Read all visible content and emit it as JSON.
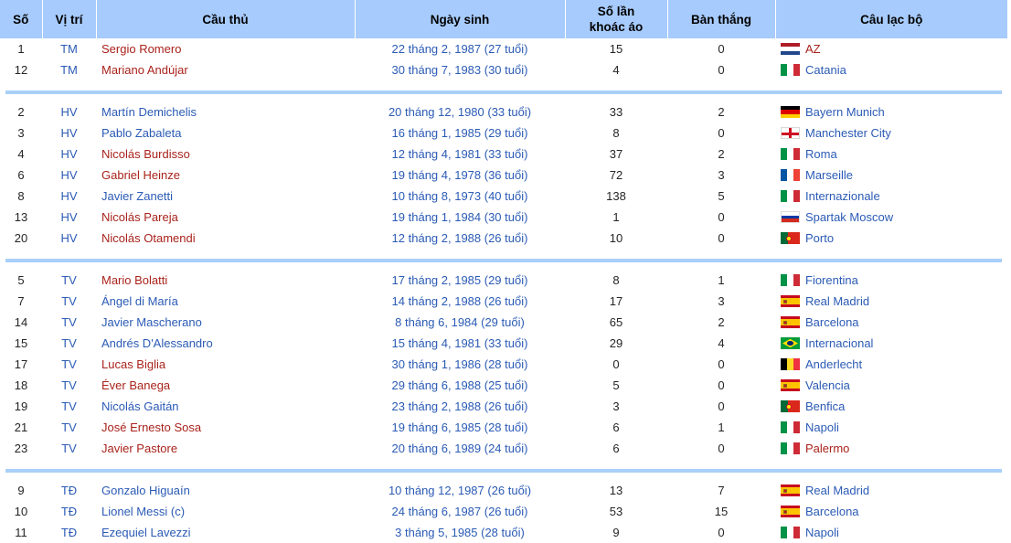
{
  "table": {
    "headers": [
      {
        "label": "Số",
        "name": "col-number"
      },
      {
        "label": "Vị trí",
        "name": "col-position"
      },
      {
        "label": "Cầu thủ",
        "name": "col-player"
      },
      {
        "label": "Ngày sinh",
        "name": "col-dob"
      },
      {
        "label": "Số lần\nkhoác áo",
        "line1": "Số lần",
        "line2": "khoác áo",
        "name": "col-caps"
      },
      {
        "label": "Bàn thắng",
        "name": "col-goals"
      },
      {
        "label": "Câu lạc bộ",
        "name": "col-club"
      }
    ],
    "groups": [
      {
        "position_group": "TM",
        "rows": [
          {
            "number": "1",
            "position": "TM",
            "player": "Sergio Romero",
            "player_color": "red",
            "dob": "22 tháng 2, 1987 (27 tuổi)",
            "caps": "15",
            "goals": "0",
            "club": "AZ",
            "club_color": "red",
            "flag": "nl"
          },
          {
            "number": "12",
            "position": "TM",
            "player": "Mariano Andújar",
            "player_color": "red",
            "dob": "30 tháng 7, 1983 (30 tuổi)",
            "caps": "4",
            "goals": "0",
            "club": "Catania",
            "club_color": "blue",
            "flag": "it"
          }
        ]
      },
      {
        "position_group": "HV",
        "rows": [
          {
            "number": "2",
            "position": "HV",
            "player": "Martín Demichelis",
            "player_color": "blue",
            "dob": "20 tháng 12, 1980 (33 tuổi)",
            "caps": "33",
            "goals": "2",
            "club": "Bayern Munich",
            "club_color": "blue",
            "flag": "de"
          },
          {
            "number": "3",
            "position": "HV",
            "player": "Pablo Zabaleta",
            "player_color": "blue",
            "dob": "16 tháng 1, 1985 (29 tuổi)",
            "caps": "8",
            "goals": "0",
            "club": "Manchester City",
            "club_color": "blue",
            "flag": "en"
          },
          {
            "number": "4",
            "position": "HV",
            "player": "Nicolás Burdisso",
            "player_color": "red",
            "dob": "12 tháng 4, 1981 (33 tuổi)",
            "caps": "37",
            "goals": "2",
            "club": "Roma",
            "club_color": "blue",
            "flag": "it"
          },
          {
            "number": "6",
            "position": "HV",
            "player": "Gabriel Heinze",
            "player_color": "red",
            "dob": "19 tháng 4, 1978 (36 tuổi)",
            "caps": "72",
            "goals": "3",
            "club": "Marseille",
            "club_color": "blue",
            "flag": "fr"
          },
          {
            "number": "8",
            "position": "HV",
            "player": "Javier Zanetti",
            "player_color": "blue",
            "dob": "10 tháng 8, 1973 (40 tuổi)",
            "caps": "138",
            "goals": "5",
            "club": "Internazionale",
            "club_color": "blue",
            "flag": "it"
          },
          {
            "number": "13",
            "position": "HV",
            "player": "Nicolás Pareja",
            "player_color": "red",
            "dob": "19 tháng 1, 1984 (30 tuổi)",
            "caps": "1",
            "goals": "0",
            "club": "Spartak Moscow",
            "club_color": "blue",
            "flag": "ru"
          },
          {
            "number": "20",
            "position": "HV",
            "player": "Nicolás Otamendi",
            "player_color": "red",
            "dob": "12 tháng 2, 1988 (26 tuổi)",
            "caps": "10",
            "goals": "0",
            "club": "Porto",
            "club_color": "blue",
            "flag": "pt"
          }
        ]
      },
      {
        "position_group": "TV",
        "rows": [
          {
            "number": "5",
            "position": "TV",
            "player": "Mario Bolatti",
            "player_color": "red",
            "dob": "17 tháng 2, 1985 (29 tuổi)",
            "caps": "8",
            "goals": "1",
            "club": "Fiorentina",
            "club_color": "blue",
            "flag": "it"
          },
          {
            "number": "7",
            "position": "TV",
            "player": "Ángel di María",
            "player_color": "blue",
            "dob": "14 tháng 2, 1988 (26 tuổi)",
            "caps": "17",
            "goals": "3",
            "club": "Real Madrid",
            "club_color": "blue",
            "flag": "es"
          },
          {
            "number": "14",
            "position": "TV",
            "player": "Javier Mascherano",
            "player_color": "blue",
            "dob": "8 tháng 6, 1984 (29 tuổi)",
            "caps": "65",
            "goals": "2",
            "club": "Barcelona",
            "club_color": "blue",
            "flag": "es"
          },
          {
            "number": "15",
            "position": "TV",
            "player": "Andrés D'Alessandro",
            "player_color": "blue",
            "dob": "15 tháng 4, 1981 (33 tuổi)",
            "caps": "29",
            "goals": "4",
            "club": "Internacional",
            "club_color": "blue",
            "flag": "br"
          },
          {
            "number": "17",
            "position": "TV",
            "player": "Lucas Biglia",
            "player_color": "red",
            "dob": "30 tháng 1, 1986 (28 tuổi)",
            "caps": "0",
            "goals": "0",
            "club": "Anderlecht",
            "club_color": "blue",
            "flag": "be"
          },
          {
            "number": "18",
            "position": "TV",
            "player": "Éver Banega",
            "player_color": "red",
            "dob": "29 tháng 6, 1988 (25 tuổi)",
            "caps": "5",
            "goals": "0",
            "club": "Valencia",
            "club_color": "blue",
            "flag": "es"
          },
          {
            "number": "19",
            "position": "TV",
            "player": "Nicolás Gaitán",
            "player_color": "blue",
            "dob": "23 tháng 2, 1988 (26 tuổi)",
            "caps": "3",
            "goals": "0",
            "club": "Benfica",
            "club_color": "blue",
            "flag": "pt"
          },
          {
            "number": "21",
            "position": "TV",
            "player": "José Ernesto Sosa",
            "player_color": "red",
            "dob": "19 tháng 6, 1985 (28 tuổi)",
            "caps": "6",
            "goals": "1",
            "club": "Napoli",
            "club_color": "blue",
            "flag": "it"
          },
          {
            "number": "23",
            "position": "TV",
            "player": "Javier Pastore",
            "player_color": "red",
            "dob": "20 tháng 6, 1989 (24 tuổi)",
            "caps": "6",
            "goals": "0",
            "club": "Palermo",
            "club_color": "red",
            "flag": "it"
          }
        ]
      },
      {
        "position_group": "TĐ",
        "rows": [
          {
            "number": "9",
            "position": "TĐ",
            "player": "Gonzalo Higuaín",
            "player_color": "blue",
            "dob": "10 tháng 12, 1987 (26 tuổi)",
            "caps": "13",
            "goals": "7",
            "club": "Real Madrid",
            "club_color": "blue",
            "flag": "es"
          },
          {
            "number": "10",
            "position": "TĐ",
            "player": "Lionel Messi (c)",
            "player_color": "blue",
            "dob": "24 tháng 6, 1987 (26 tuổi)",
            "caps": "53",
            "goals": "15",
            "club": "Barcelona",
            "club_color": "blue",
            "flag": "es"
          },
          {
            "number": "11",
            "position": "TĐ",
            "player": "Ezequiel Lavezzi",
            "player_color": "blue",
            "dob": "3 tháng 5, 1985 (28 tuổi)",
            "caps": "9",
            "goals": "0",
            "club": "Napoli",
            "club_color": "blue",
            "flag": "it"
          }
        ]
      }
    ]
  },
  "colors": {
    "header_bg": "#a7cbfc",
    "separator": "#a8d0f8",
    "link_blue": "#2b5bb5",
    "link_red": "#a9231c"
  }
}
